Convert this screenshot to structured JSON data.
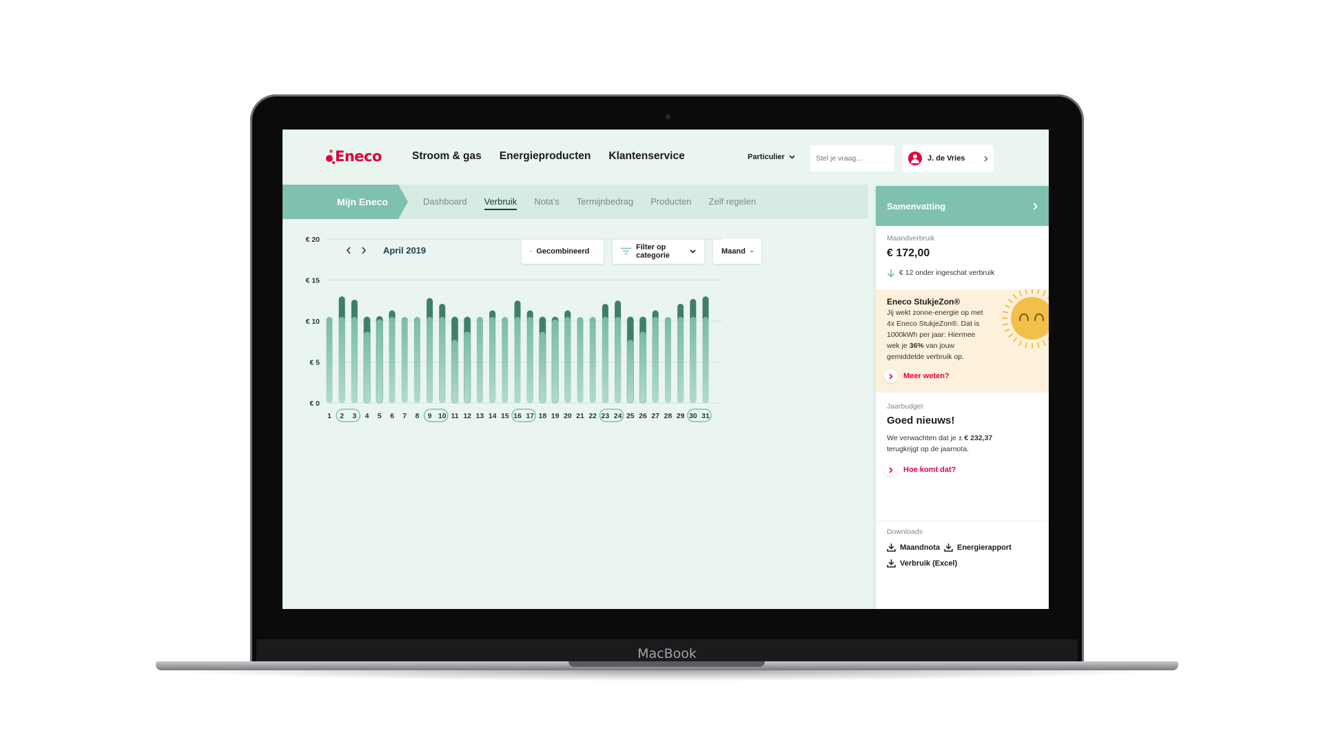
{
  "device": {
    "label": "MacBook"
  },
  "nav": {
    "logo": "Eneco",
    "items": [
      "Stroom & gas",
      "Energieproducten",
      "Klantenservice"
    ],
    "segment": "Particulier",
    "search_placeholder": "Stel je vraag...",
    "user": "J. de Vries"
  },
  "subnav": {
    "home": "Mijn Eneco",
    "tabs": [
      "Dashboard",
      "Verbruik",
      "Nota's",
      "Termijnbedrag",
      "Producten",
      "Zelf regelen"
    ],
    "active_tab": "Verbruik"
  },
  "controls": {
    "month": "April 2019",
    "type_dropdown": "Gecombineerd",
    "filter_dropdown": "Filter op categorie",
    "period_dropdown": "Maand"
  },
  "chart_data": {
    "type": "bar",
    "y_ticks": [
      "€ 20",
      "€ 15",
      "€ 10",
      "€ 5",
      "€ 0"
    ],
    "ylim": [
      0,
      20
    ],
    "categories": [
      "1",
      "2",
      "3",
      "4",
      "5",
      "6",
      "7",
      "8",
      "9",
      "10",
      "11",
      "12",
      "13",
      "14",
      "15",
      "16",
      "17",
      "18",
      "19",
      "20",
      "21",
      "22",
      "23",
      "24",
      "25",
      "26",
      "27",
      "28",
      "29",
      "30",
      "31"
    ],
    "highlighted_pairs": [
      [
        "2",
        "3"
      ],
      [
        "9",
        "10"
      ],
      [
        "16",
        "17"
      ],
      [
        "23",
        "24"
      ],
      [
        "30",
        "31"
      ]
    ],
    "series": [
      {
        "values": [
          10.5,
          10.5,
          10.5,
          8.7,
          10.2,
          10.5,
          10.5,
          10.5,
          10.5,
          10.5,
          7.7,
          8.7,
          10.5,
          10.5,
          10.5,
          10.5,
          10.5,
          8.7,
          10.2,
          10.5,
          10.5,
          10.5,
          10.5,
          10.5,
          7.7,
          8.7,
          10.5,
          10.5,
          10.5,
          10.5,
          10.5
        ]
      },
      {
        "values": [
          10.5,
          13.0,
          12.6,
          10.5,
          10.6,
          11.3,
          10.5,
          10.5,
          12.8,
          12.1,
          10.5,
          10.5,
          10.5,
          11.3,
          10.5,
          12.5,
          11.3,
          10.5,
          10.5,
          11.3,
          10.5,
          10.5,
          12.1,
          12.5,
          10.5,
          10.5,
          11.3,
          10.5,
          12.1,
          12.7,
          13.0
        ]
      }
    ],
    "colors": {
      "bar_base": "#88c2b1",
      "bar_over": "#3f7e6c",
      "outline": "#7fbfad",
      "grid": "#cfe2da"
    }
  },
  "panel": {
    "title": "Samenvatting",
    "month_label": "Maandverbruik",
    "month_value": "€ 172,00",
    "month_delta": "€ 12 onder ingeschat verbruik",
    "sun_title": "Eneco StukjeZon®",
    "sun_text_1": "Jij wekt zonne-energie op met",
    "sun_text_2": "4x Eneco StukjeZon®. Dat is",
    "sun_text_3": "1000kWh per jaar: Hiermee",
    "sun_text_4a": "wek je ",
    "sun_text_4b": "36%",
    "sun_text_4c": " van jouw",
    "sun_text_5": "gemiddelde verbruik op.",
    "sun_link": "Meer weten?",
    "budget_label": "Jaarbudget",
    "budget_title": "Goed nieuws!",
    "budget_text_1a": "We verwachten dat je ± ",
    "budget_text_1b": "€ 232,37",
    "budget_text_2": "terugkrijgt op de jaarnota.",
    "budget_link": "Hoe komt dat?",
    "downloads_label": "Downloads",
    "downloads": [
      "Maandnota",
      "Energierapport",
      "Verbruik (Excel)"
    ]
  },
  "colors": {
    "brand": "#e3003f",
    "accent": "#7fc0ae",
    "background": "#eaf5f0",
    "sun": "#f2c04a"
  }
}
